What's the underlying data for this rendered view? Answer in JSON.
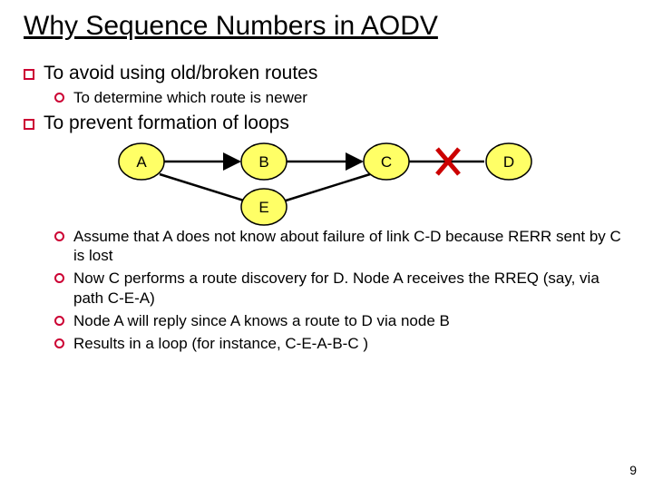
{
  "title": "Why Sequence Numbers in AODV",
  "bullets": {
    "b1": "To avoid using old/broken routes",
    "b1_1": "To determine which route is newer",
    "b2": "To prevent formation of loops",
    "b2_1": "Assume that A does not know about failure of link C-D because RERR sent by C is lost",
    "b2_2": "Now C performs a route discovery for D. Node A receives the RREQ (say, via path C-E-A)",
    "b2_3": "Node A will reply since A knows a route to D via node B",
    "b2_4": "Results in a loop (for instance, C-E-A-B-C )"
  },
  "diagram": {
    "nodes": {
      "A": "A",
      "B": "B",
      "C": "C",
      "D": "D",
      "E": "E"
    }
  },
  "page": "9"
}
